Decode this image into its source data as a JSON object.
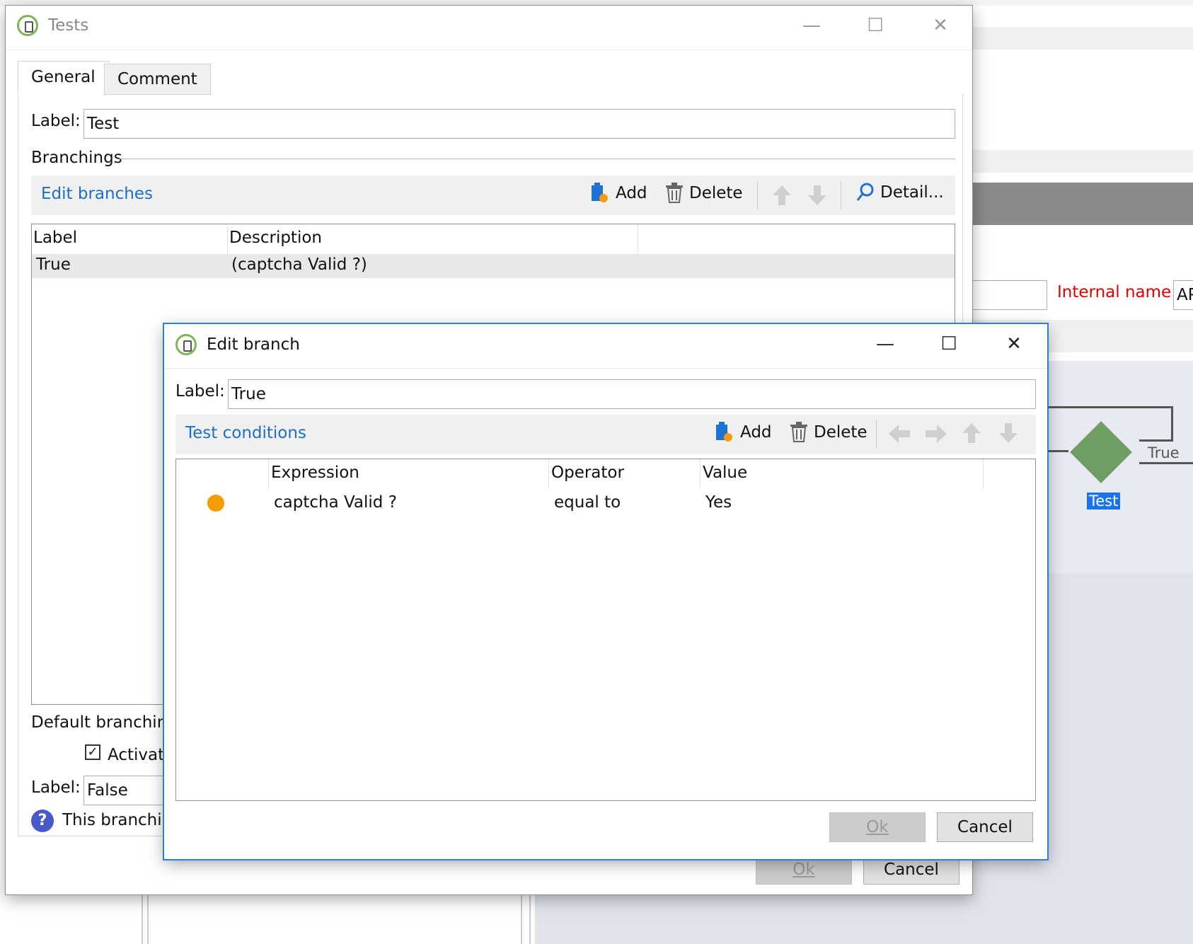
{
  "background": {
    "internal_name_label": "Internal name:",
    "internal_name_value": "AP",
    "diagram": {
      "node_label": "Test",
      "branch_label": "True",
      "node_color": "#6e9e63"
    }
  },
  "tests_window": {
    "title": "Tests",
    "tabs": [
      {
        "label": "General"
      },
      {
        "label": "Comment"
      }
    ],
    "label_caption": "Label:",
    "label_value": "Test",
    "branchings_heading": "Branchings",
    "toolbar": {
      "edit_link": "Edit branches",
      "add_label": "Add",
      "delete_label": "Delete",
      "detail_label": "Detail..."
    },
    "table": {
      "columns": [
        "Label",
        "Description"
      ],
      "rows": [
        {
          "label": "True",
          "description": "(captcha Valid ?)"
        }
      ]
    },
    "default_branching_heading": "Default branching",
    "activate_label": "Activate",
    "default_label_caption": "Label:",
    "default_label_value": "False",
    "help_text": "This branching",
    "ok_label": "Ok",
    "cancel_label": "Cancel"
  },
  "edit_branch_window": {
    "title": "Edit branch",
    "label_caption": "Label:",
    "label_value": "True",
    "toolbar": {
      "conditions_link": "Test conditions",
      "add_label": "Add",
      "delete_label": "Delete"
    },
    "table": {
      "columns": [
        "Expression",
        "Operator",
        "Value"
      ],
      "rows": [
        {
          "status_icon": "orange-dot-icon",
          "expression": "captcha Valid ?",
          "operator": "equal to",
          "value": "Yes"
        }
      ]
    },
    "ok_label": "Ok",
    "cancel_label": "Cancel",
    "accent_color": "#2b7fd8",
    "status_color": "#f59d00"
  }
}
